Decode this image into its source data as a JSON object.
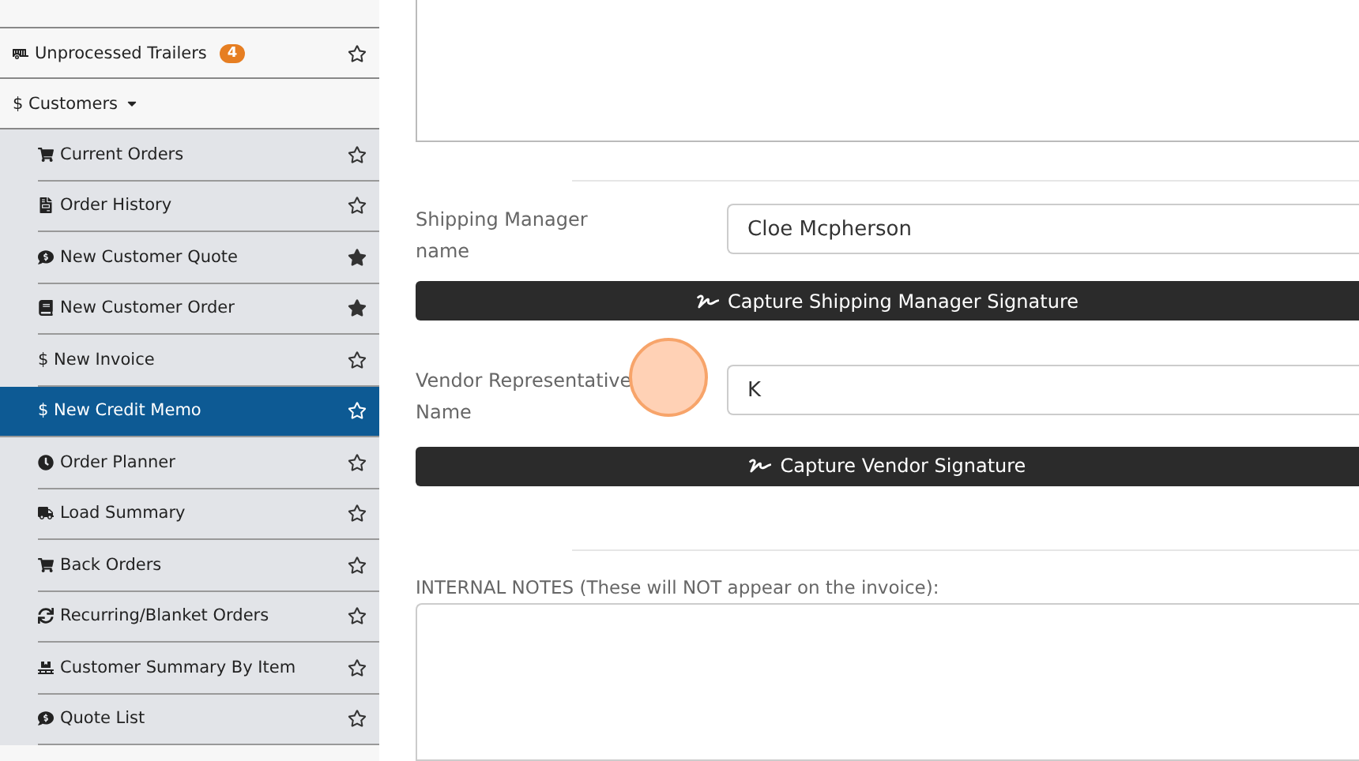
{
  "sidebar": {
    "top_items": [
      {
        "label": "Unprocessed Trailers",
        "kind": "trailer",
        "badge": "4",
        "starred": false
      }
    ],
    "section": {
      "label": "$ Customers",
      "expanded": true
    },
    "items": [
      {
        "label": "Current Orders",
        "kind": "cart",
        "starred": false,
        "selected": false
      },
      {
        "label": "Order History",
        "kind": "file",
        "starred": false,
        "selected": false
      },
      {
        "label": "New Customer Quote",
        "kind": "comment",
        "starred": true,
        "selected": false
      },
      {
        "label": "New Customer Order",
        "kind": "book",
        "starred": true,
        "selected": false
      },
      {
        "label": "$ New Invoice",
        "kind": "plain",
        "starred": false,
        "selected": false
      },
      {
        "label": "$ New Credit Memo",
        "kind": "plain",
        "starred": false,
        "selected": true
      },
      {
        "label": "Order Planner",
        "kind": "clock",
        "starred": false,
        "selected": false
      },
      {
        "label": "Load Summary",
        "kind": "truck",
        "starred": false,
        "selected": false
      },
      {
        "label": "Back Orders",
        "kind": "cart",
        "starred": false,
        "selected": false
      },
      {
        "label": "Recurring/Blanket Orders",
        "kind": "repeat",
        "starred": false,
        "selected": false
      },
      {
        "label": "Customer Summary By Item",
        "kind": "pallet",
        "starred": false,
        "selected": false
      },
      {
        "label": "Quote List",
        "kind": "comment",
        "starred": false,
        "selected": false
      }
    ]
  },
  "form": {
    "shipping_manager": {
      "label": "Shipping Manager name",
      "value": "Cloe Mcpherson",
      "button": "Capture Shipping Manager Signature"
    },
    "vendor_rep": {
      "label": "Vendor Representative Name",
      "value": "K",
      "button": "Capture Vendor Signature"
    },
    "internal_notes": {
      "label": "INTERNAL NOTES (These will NOT appear on the invoice):"
    }
  }
}
